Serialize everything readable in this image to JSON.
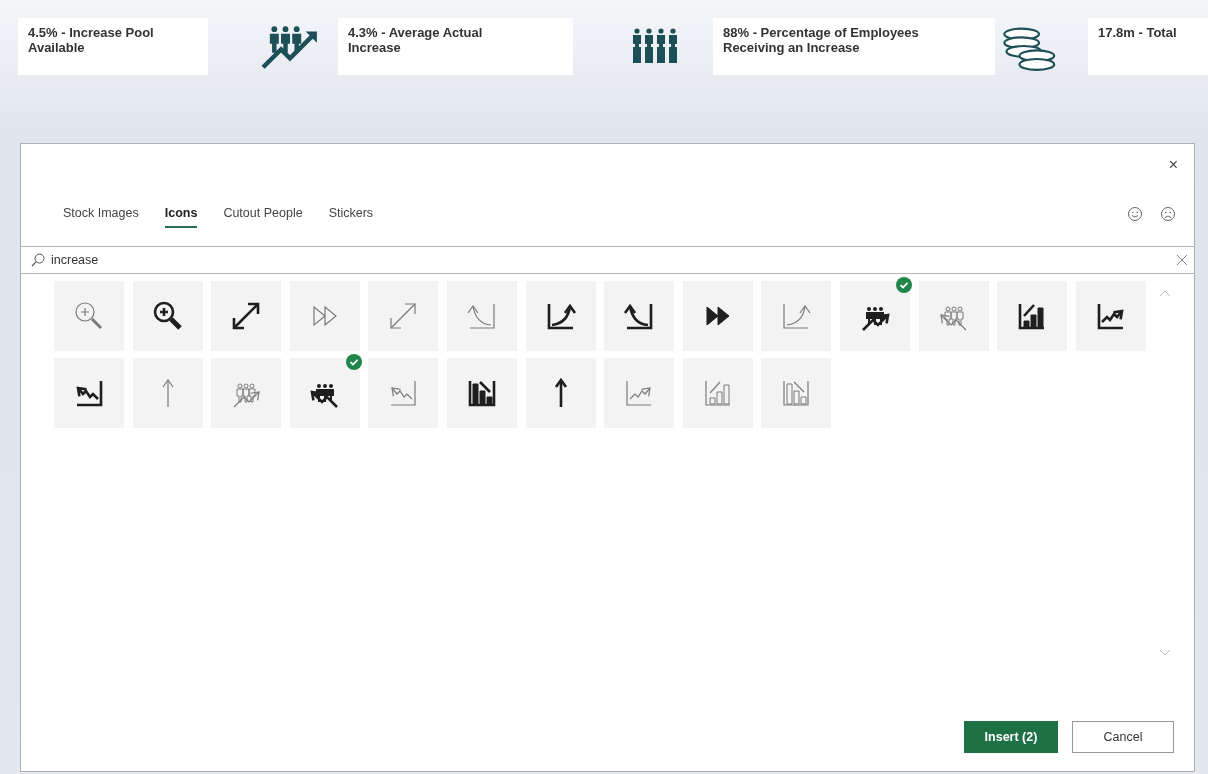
{
  "kpis": [
    {
      "text": "4.5%  - Increase Pool Available"
    },
    {
      "text": "4.3%  - Average Actual Increase"
    },
    {
      "text": "88%  - Percentage of Employees Receiving an Increase"
    },
    {
      "text": "17.8m - Total"
    }
  ],
  "dialog": {
    "close": "×",
    "tabs": [
      {
        "label": "Stock Images",
        "selected": false
      },
      {
        "label": "Icons",
        "selected": true
      },
      {
        "label": "Cutout People",
        "selected": false
      },
      {
        "label": "Stickers",
        "selected": false
      }
    ],
    "search": {
      "value": "increase"
    },
    "icons": [
      {
        "kind": "zoom-thin",
        "selected": false
      },
      {
        "kind": "zoom-bold",
        "selected": false
      },
      {
        "kind": "diagonal-bold",
        "selected": false
      },
      {
        "kind": "forward-thin",
        "selected": false
      },
      {
        "kind": "diagonal-thin",
        "selected": false
      },
      {
        "kind": "curveleft-thin",
        "selected": false
      },
      {
        "kind": "curveright-bold",
        "selected": false
      },
      {
        "kind": "curveleft-bold",
        "selected": false
      },
      {
        "kind": "forward-bold",
        "selected": false
      },
      {
        "kind": "curveright-thin",
        "selected": false
      },
      {
        "kind": "peopleup-bold",
        "selected": true
      },
      {
        "kind": "peopledown-thin",
        "selected": false
      },
      {
        "kind": "barup-bold",
        "selected": false
      },
      {
        "kind": "lineup-bold",
        "selected": false
      },
      {
        "kind": "linedown-bold",
        "selected": false
      },
      {
        "kind": "arrow-thin",
        "selected": false
      },
      {
        "kind": "peopleup-thin",
        "selected": false
      },
      {
        "kind": "peopledown-bold",
        "selected": true
      },
      {
        "kind": "linedown-thin",
        "selected": false
      },
      {
        "kind": "bardown-bold",
        "selected": false
      },
      {
        "kind": "arrow-bold",
        "selected": false
      },
      {
        "kind": "lineup-thin",
        "selected": false
      },
      {
        "kind": "barup-thin",
        "selected": false
      },
      {
        "kind": "bardown-thin",
        "selected": false
      }
    ],
    "buttons": [
      {
        "label": "Insert (2)",
        "kind": "primary"
      },
      {
        "label": "Cancel",
        "kind": "secondary"
      }
    ]
  }
}
